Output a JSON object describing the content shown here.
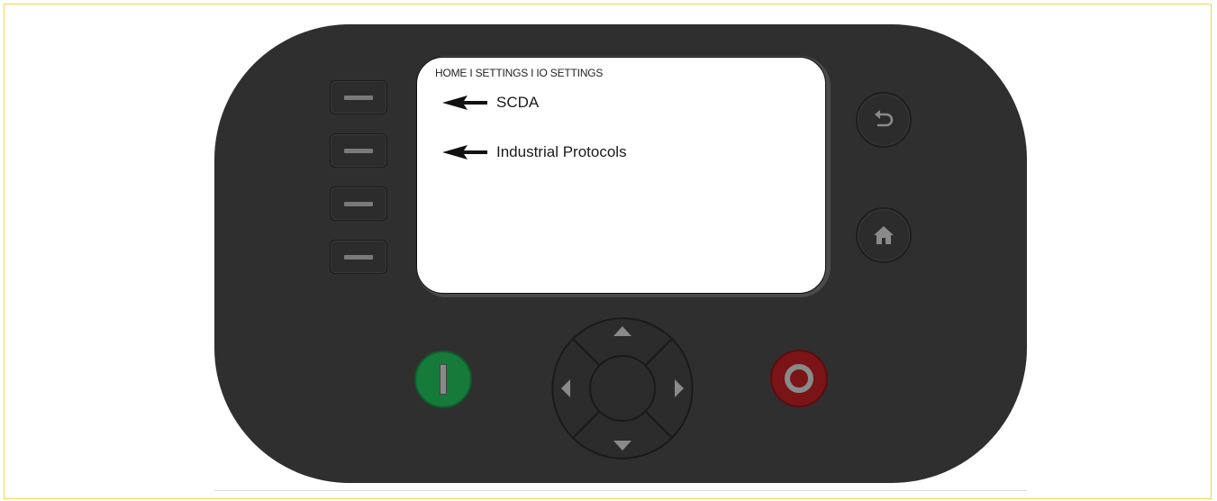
{
  "screen": {
    "breadcrumb": "HOME I SETTINGS I IO SETTINGS",
    "menu": [
      {
        "label": "SCDA"
      },
      {
        "label": "Industrial Protocols"
      }
    ]
  },
  "device": {
    "soft_keys": 4,
    "icons": {
      "back": "undo-arrow-icon",
      "home": "home-icon",
      "start": "power-on-icon",
      "stop": "power-off-icon",
      "dpad": [
        "up-arrow-icon",
        "down-arrow-icon",
        "left-arrow-icon",
        "right-arrow-icon"
      ]
    },
    "colors": {
      "body": "#2f2f2f",
      "start": "#167a3b",
      "stop": "#7a1416",
      "screen": "#ffffff"
    }
  }
}
